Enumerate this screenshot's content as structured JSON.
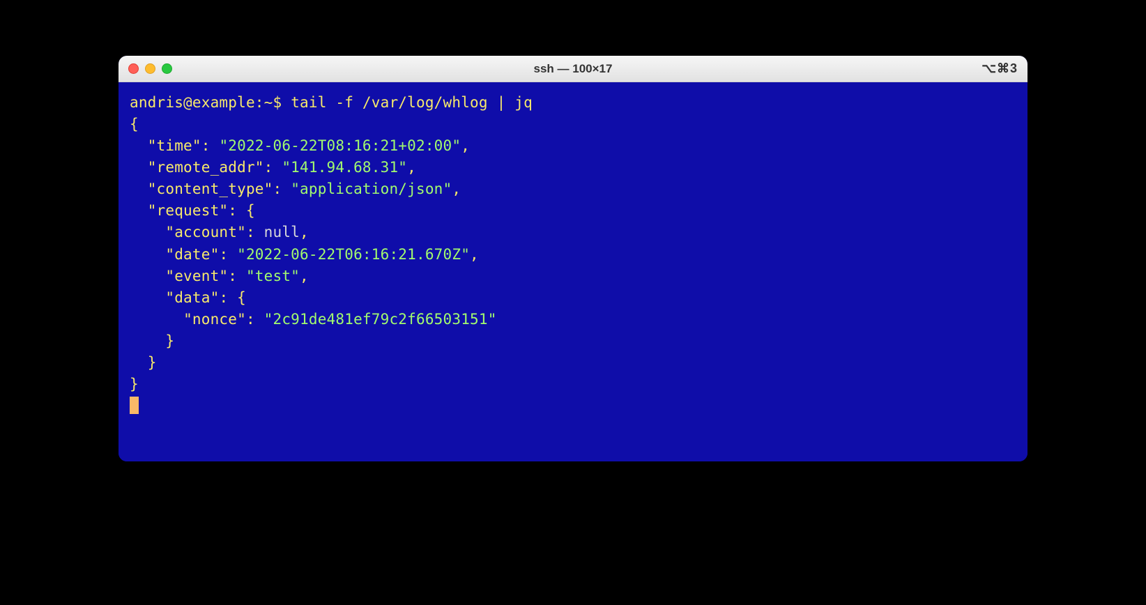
{
  "window": {
    "title": "ssh — 100×17",
    "shortcut": "⌥⌘3"
  },
  "prompt": {
    "user_host": "andris@example:~$",
    "command": "tail -f /var/log/whlog | jq"
  },
  "json_output": {
    "open": "{",
    "time_key": "\"time\"",
    "time_val": "\"2022-06-22T08:16:21+02:00\"",
    "remote_addr_key": "\"remote_addr\"",
    "remote_addr_val": "\"141.94.68.31\"",
    "content_type_key": "\"content_type\"",
    "content_type_val": "\"application/json\"",
    "request_key": "\"request\"",
    "request_open": "{",
    "account_key": "\"account\"",
    "account_val": "null",
    "date_key": "\"date\"",
    "date_val": "\"2022-06-22T06:16:21.670Z\"",
    "event_key": "\"event\"",
    "event_val": "\"test\"",
    "data_key": "\"data\"",
    "data_open": "{",
    "nonce_key": "\"nonce\"",
    "nonce_val": "\"2c91de481ef79c2f66503151\"",
    "data_close": "}",
    "request_close": "}",
    "close": "}"
  },
  "punct": {
    "colon": ":",
    "comma": ",",
    "colon_space": ": "
  }
}
